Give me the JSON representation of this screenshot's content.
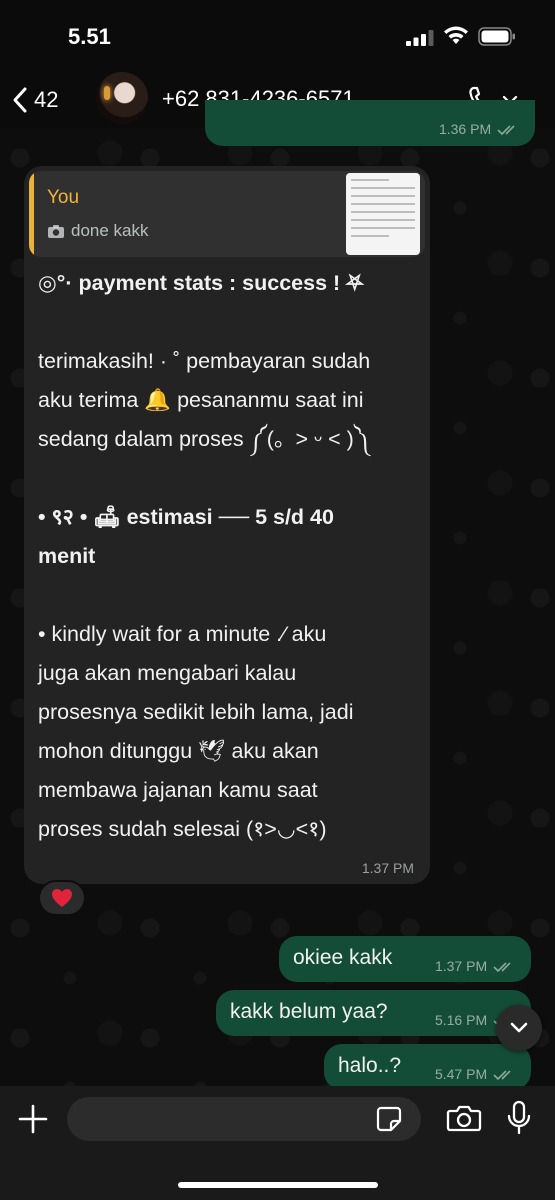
{
  "status_bar": {
    "time": "5.51"
  },
  "header": {
    "unread_count": "42",
    "contact_name": "+62 831-4236-6571"
  },
  "previous_message": {
    "time": "1.36 PM"
  },
  "incoming_message": {
    "quote": {
      "author": "You",
      "text": "done kakk"
    },
    "lines": {
      "l1": "◎°· payment stats : success !  ⛧",
      "l2": "terimakasih! · ˚ pembayaran sudah",
      "l3": "aku terima 🔔 pesananmu saat ini",
      "l4": "sedang dalam proses ༼(。> ᵕ < )༽",
      "l5": "•  ९२  •  🛋 estimasi ── 5 s/d 40",
      "l6": "menit",
      "l7": "• kindly wait for a minute .⁄ aku",
      "l8": "juga akan mengabari kalau",
      "l9": "prosesnya sedikit lebih lama,  jadi",
      "l10": "mohon ditunggu 🕊 aku akan",
      "l11": "membawa jajanan kamu saat",
      "l12": "proses sudah selesai (१>◡<१)"
    },
    "time": "1.37 PM",
    "reaction": "heart"
  },
  "outgoing_messages": [
    {
      "text": "okiee kakk",
      "time": "1.37 PM"
    },
    {
      "text": "kakk belum yaa?",
      "time": "5.16 PM"
    },
    {
      "text": "halo..?",
      "time": "5.47 PM"
    }
  ],
  "composer": {
    "placeholder": ""
  },
  "colors": {
    "outgoing_bubble": "#144d37",
    "incoming_bubble": "#232323",
    "quote_accent": "#e9b23b",
    "read_tick": "#8fa89c"
  }
}
